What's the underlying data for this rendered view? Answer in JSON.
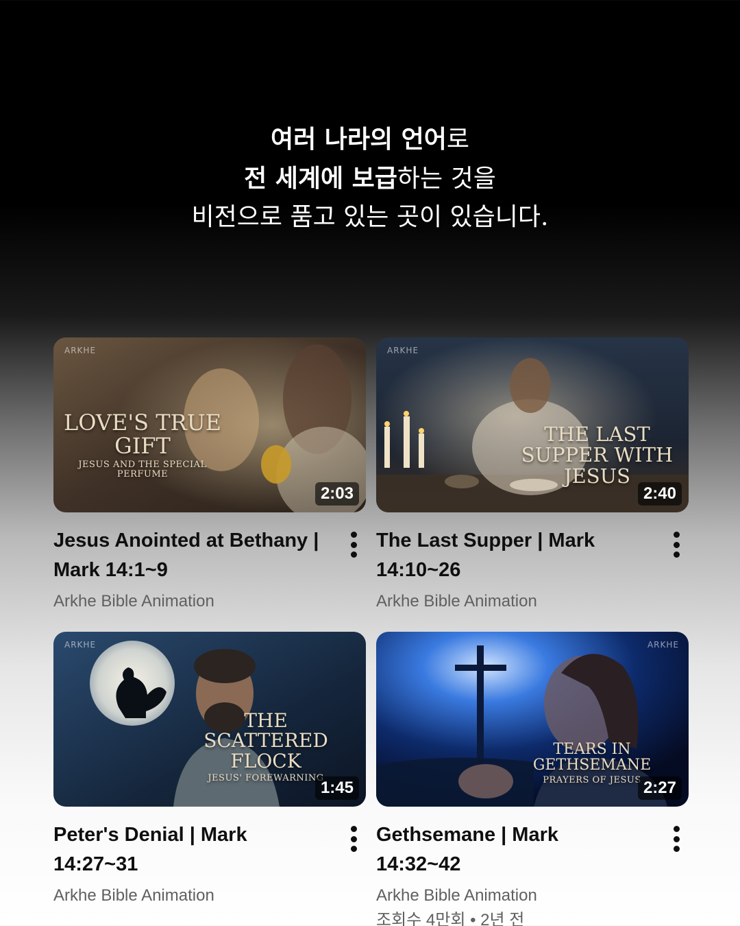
{
  "headline": {
    "line1_bold": "여러 나라의 언어",
    "line1_light": "로",
    "line2_bold": "전 세계에 보급",
    "line2_light": "하는 것을",
    "line3": "비전으로 품고 있는 곳이 있습니다."
  },
  "videos": [
    {
      "title": "Jesus Anointed at Bethany | Mark 14:1~9",
      "channel": "Arkhe Bible Animation",
      "duration": "2:03",
      "brand": "ARKHE",
      "thumb_title": "LOVE'S TRUE GIFT",
      "thumb_subtitle": "JESUS AND THE SPECIAL PERFUME"
    },
    {
      "title": "The Last Supper | Mark 14:10~26",
      "channel": "Arkhe Bible Animation",
      "duration": "2:40",
      "brand": "ARKHE",
      "thumb_title": "THE LAST SUPPER WITH JESUS"
    },
    {
      "title": "Peter's Denial | Mark 14:27~31",
      "channel": "Arkhe Bible Animation",
      "duration": "1:45",
      "brand": "ARKHE",
      "thumb_title_1": "THE",
      "thumb_title_2": "SCATTERED FLOCK",
      "thumb_subtitle": "JESUS' FOREWARNING"
    },
    {
      "title": "Gethsemane | Mark 14:32~42",
      "channel": "Arkhe Bible Animation",
      "stats": "조회수 4만회 • 2년 전",
      "duration": "2:27",
      "brand": "ARKHE",
      "thumb_title": "TEARS IN GETHSEMANE",
      "thumb_subtitle": "PRAYERS OF JESUS"
    }
  ],
  "icons": {
    "more": "more-vert-icon"
  }
}
